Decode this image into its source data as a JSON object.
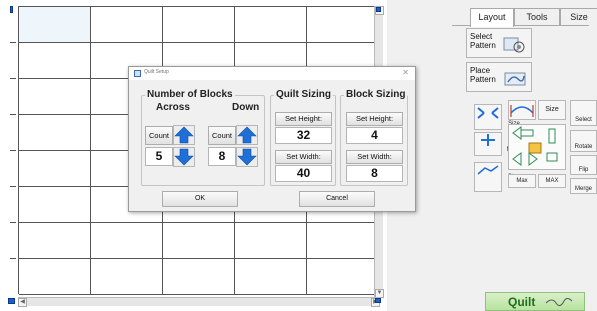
{
  "dialog": {
    "title": "Quilt Setup",
    "close_symbol": "✕",
    "number_of_blocks": {
      "group_label": "Number of Blocks",
      "across_label": "Across",
      "down_label": "Down",
      "count_label": "Count",
      "across_value": "5",
      "down_value": "8"
    },
    "quilt_sizing": {
      "group_label": "Quilt Sizing",
      "set_height_label": "Set Height:",
      "height_value": "32",
      "set_width_label": "Set Width:",
      "width_value": "40"
    },
    "block_sizing": {
      "group_label": "Block Sizing",
      "set_height_label": "Set Height:",
      "height_value": "4",
      "set_width_label": "Set Width:",
      "width_value": "8"
    },
    "ok_label": "OK",
    "cancel_label": "Cancel"
  },
  "panel": {
    "tabs": [
      {
        "label": "Layout",
        "active": true
      },
      {
        "label": "Tools",
        "active": false
      },
      {
        "label": "Size",
        "active": false
      }
    ],
    "select_pattern_label": "Select Pattern",
    "place_pattern_label": "Place Pattern",
    "tools": {
      "size_label": "Size",
      "move_label": "Move",
      "step_label": "Step",
      "tiny_label": "tiny",
      "max_label": "Max",
      "max2_label": "MAX",
      "select_label": "Select",
      "rotate_label": "Rotate",
      "flip_label": "Flip",
      "merge_label": "Merge"
    },
    "quilt_button_label": "Quilt"
  },
  "colors": {
    "arrow_blue": "#1f6fd6",
    "quilt_green": "#b7e3a0",
    "accent_blue": "#1a5fd0"
  },
  "icons": [
    "window-icon",
    "close-icon",
    "arrow-up-icon",
    "arrow-down-icon",
    "pattern-icon",
    "quilt-pattern-icon"
  ]
}
